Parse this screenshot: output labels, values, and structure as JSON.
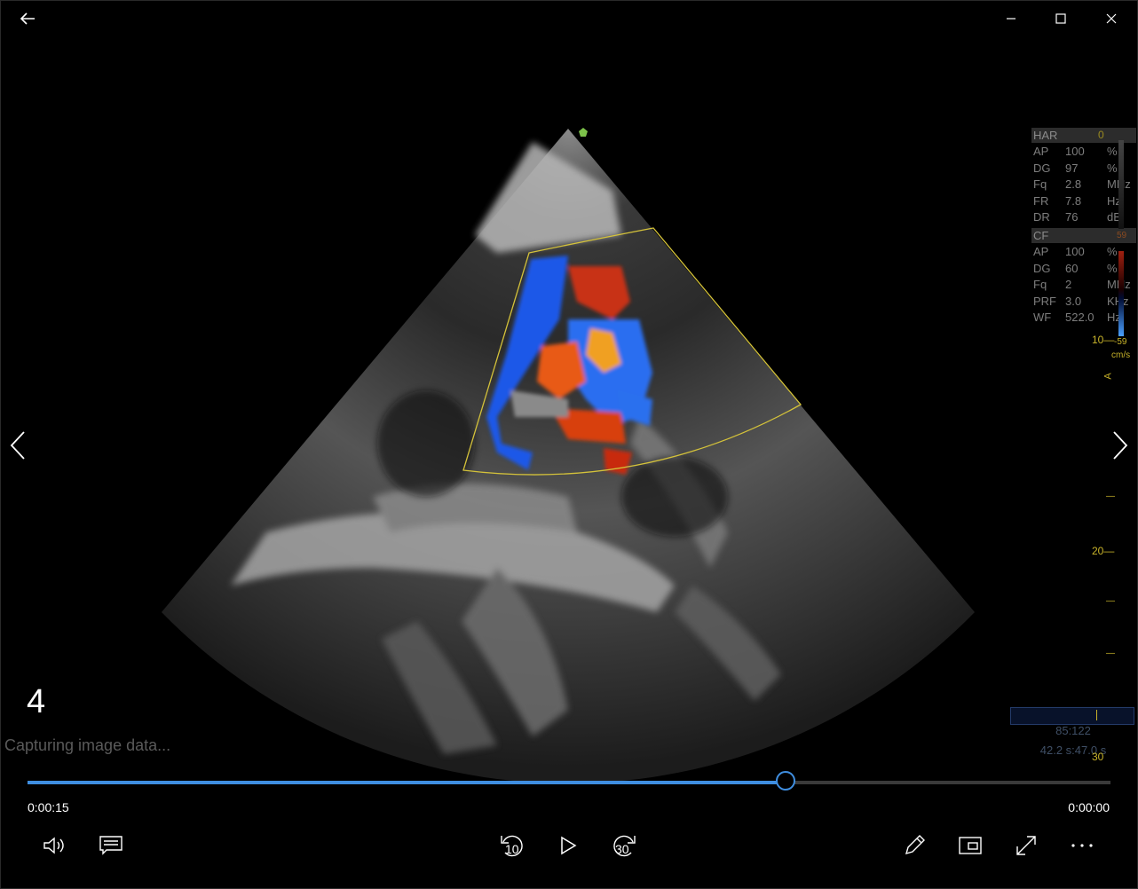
{
  "window": {
    "back_icon": "back-arrow-icon",
    "minimize_icon": "minimize-icon",
    "maximize_icon": "maximize-icon",
    "close_icon": "close-icon"
  },
  "nav": {
    "prev_icon": "chevron-left-icon",
    "next_icon": "chevron-right-icon"
  },
  "params": {
    "har_header": "HAR",
    "har_scale_top": "0",
    "har_rows": [
      {
        "k": "AP",
        "v": "100",
        "u": "%"
      },
      {
        "k": "DG",
        "v": "97",
        "u": "%"
      },
      {
        "k": "Fq",
        "v": "2.8",
        "u": "MHz"
      },
      {
        "k": "FR",
        "v": "7.8",
        "u": "Hz"
      },
      {
        "k": "DR",
        "v": "76",
        "u": "dB"
      }
    ],
    "cf_header": "CF",
    "cf_scale_top": "59",
    "cf_rows": [
      {
        "k": "AP",
        "v": "100",
        "u": "%"
      },
      {
        "k": "DG",
        "v": "60",
        "u": "%"
      },
      {
        "k": "Fq",
        "v": "2",
        "u": "MHz"
      },
      {
        "k": "PRF",
        "v": "3.0",
        "u": "KHz"
      },
      {
        "k": "WF",
        "v": "522.0",
        "u": "Hz"
      }
    ]
  },
  "depth_scale": {
    "label_10": "10",
    "cf_scale_bottom": "-59",
    "units": "cm/s",
    "marker": "A",
    "label_20": "20",
    "label_30": "30"
  },
  "overlay": {
    "frame_number": "4",
    "status": "Capturing image data...",
    "ratio": "85:122",
    "time_readout": "42.2 s:47.0 s"
  },
  "player": {
    "progress": 0.7,
    "current_time": "0:00:15",
    "remaining_time": "0:00:00",
    "volume_icon": "volume-icon",
    "captions_icon": "captions-icon",
    "skip_back_icon": "skip-back-10-icon",
    "skip_back_label": "10",
    "play_icon": "play-icon",
    "skip_forward_icon": "skip-forward-30-icon",
    "skip_forward_label": "30",
    "edit_icon": "pencil-icon",
    "miniview_icon": "mini-view-icon",
    "fullscreen_icon": "fullscreen-icon",
    "more_icon": "more-icon"
  },
  "colors": {
    "accent": "#3f8ee0",
    "scale": "#c9b42a",
    "roi": "#d4c23a"
  }
}
